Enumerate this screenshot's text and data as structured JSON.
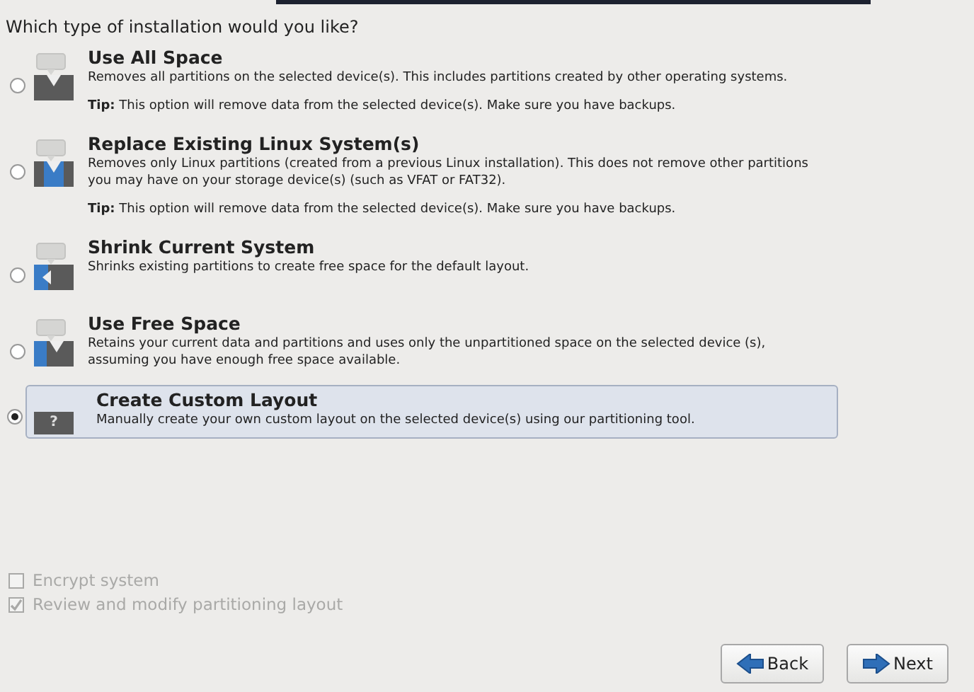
{
  "question": "Which type of installation would you like?",
  "options": [
    {
      "kind": "all",
      "title": "Use All Space",
      "description": "Removes all partitions on the selected device(s).  This includes partitions created by other operating systems.",
      "tip": "**Tip:** This option will remove data from the selected device(s).  Make sure you have backups.",
      "selected": false
    },
    {
      "kind": "replace",
      "title": "Replace Existing Linux System(s)",
      "description": "Removes only Linux partitions (created from a previous Linux installation).  This does not remove other partitions you may have on your storage device(s) (such as VFAT or FAT32).",
      "tip": "**Tip:** This option will remove data from the selected device(s).  Make sure you have backups.",
      "selected": false
    },
    {
      "kind": "shrink",
      "title": "Shrink Current System",
      "description": "Shrinks existing partitions to create free space for the default layout.",
      "selected": false
    },
    {
      "kind": "free",
      "title": "Use Free Space",
      "description": "Retains your current data and partitions and uses only the unpartitioned space on the selected device (s), assuming you have enough free space available.",
      "selected": false
    },
    {
      "kind": "custom",
      "title": "Create Custom Layout",
      "description": "Manually create your own custom layout on the selected device(s) using our partitioning tool.",
      "icon_glyph": "?",
      "selected": true
    }
  ],
  "checkboxes": [
    {
      "label": "Encrypt system",
      "checked": false,
      "disabled": true
    },
    {
      "label": "Review and modify partitioning layout",
      "checked": true,
      "disabled": true
    }
  ],
  "buttons": [
    {
      "kind": "back",
      "label": "Back"
    },
    {
      "kind": "next",
      "label": "Next"
    }
  ]
}
